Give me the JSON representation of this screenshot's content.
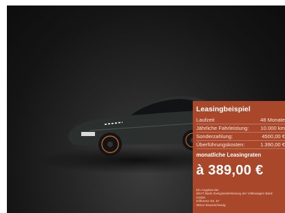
{
  "colors": {
    "panel_background": "#a8472a",
    "background": "#1a1a1a",
    "car_body": "#2a2d2c",
    "accent_wheels": "#b9622f"
  },
  "ad": {
    "title": "Leasingbeispiel",
    "rows": [
      {
        "label": "Laufzeit",
        "value": "48 Monate"
      },
      {
        "label": "Jährliche Fahrleistung:",
        "value": "10.000 km"
      },
      {
        "label": "Sonderzahlung:",
        "value": "4500,00 €"
      },
      {
        "label": "Überführungskosten:",
        "value": "1.390,00 €"
      }
    ],
    "monthly_label": "monatliche Leasingraten",
    "price": "à 389,00 €",
    "fineprint": [
      "Ein Angebot der",
      "SEAT Bank Zweigniederlassung der Volkswagen Bank",
      "GmbH",
      "Gifhorner Str. 57",
      "38112 Braunschweig"
    ]
  }
}
